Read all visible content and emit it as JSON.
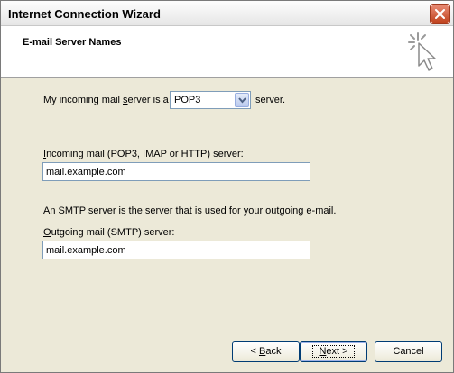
{
  "window": {
    "title": "Internet Connection Wizard"
  },
  "header": {
    "title": "E-mail Server Names"
  },
  "incoming_type": {
    "prefix": "My incoming mail ",
    "accel": "s",
    "prefix2": "erver is a",
    "selected": "POP3",
    "suffix": "server."
  },
  "incoming_server": {
    "label_accel": "I",
    "label_rest": "ncoming mail (POP3, IMAP or HTTP) server:",
    "value": "mail.example.com"
  },
  "smtp_info": "An SMTP server is the server that is used for your outgoing e-mail.",
  "outgoing_server": {
    "label_accel": "O",
    "label_rest": "utgoing mail (SMTP) server:",
    "value": "mail.example.com"
  },
  "buttons": {
    "back_prefix": "< ",
    "back_accel": "B",
    "back_rest": "ack",
    "next_accel": "N",
    "next_rest": "ext >",
    "cancel": "Cancel"
  },
  "icons": {
    "close": "close-icon",
    "wizard": "wizard-cursor-icon",
    "dropdown": "chevron-down-icon"
  },
  "colors": {
    "title_close": "#c1441f",
    "field_border": "#7f9db9"
  }
}
